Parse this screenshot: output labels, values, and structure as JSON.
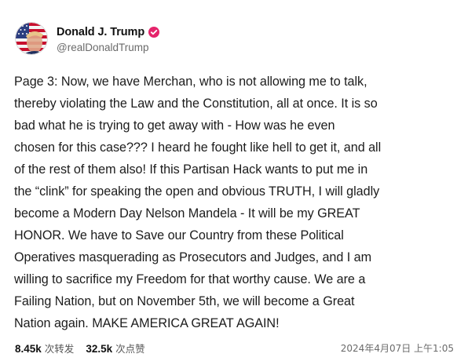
{
  "author": {
    "display_name": "Donald J. Trump",
    "handle": "@realDonaldTrump",
    "verified_icon": "verified-badge-icon",
    "verified_color": "#e5246b"
  },
  "post": {
    "text": "Page 3: Now, we have Merchan, who is not allowing me to talk,\nthereby violating the Law and the Constitution, all at once. It is so\nbad what he is trying to get away with - How was he even\nchosen for this case??? I heard he fought like hell to get it, and all\nof the rest of them also! If this Partisan Hack wants to put me in\nthe “clink” for speaking the open and obvious TRUTH, I will gladly\nbecome a Modern Day Nelson Mandela - It will be my GREAT\nHONOR. We have to Save our Country from these Political\nOperatives masquerading as Prosecutors and Judges, and I am\nwilling to sacrifice my Freedom for that worthy cause. We are a\nFailing Nation, but on November 5th, we will become a Great\nNation again. MAKE AMERICA GREAT AGAIN!"
  },
  "stats": {
    "reposts_count": "8.45k",
    "reposts_label": "次转发",
    "likes_count": "32.5k",
    "likes_label": "次点赞"
  },
  "timestamp": "2024年4月07日 上午1:05"
}
